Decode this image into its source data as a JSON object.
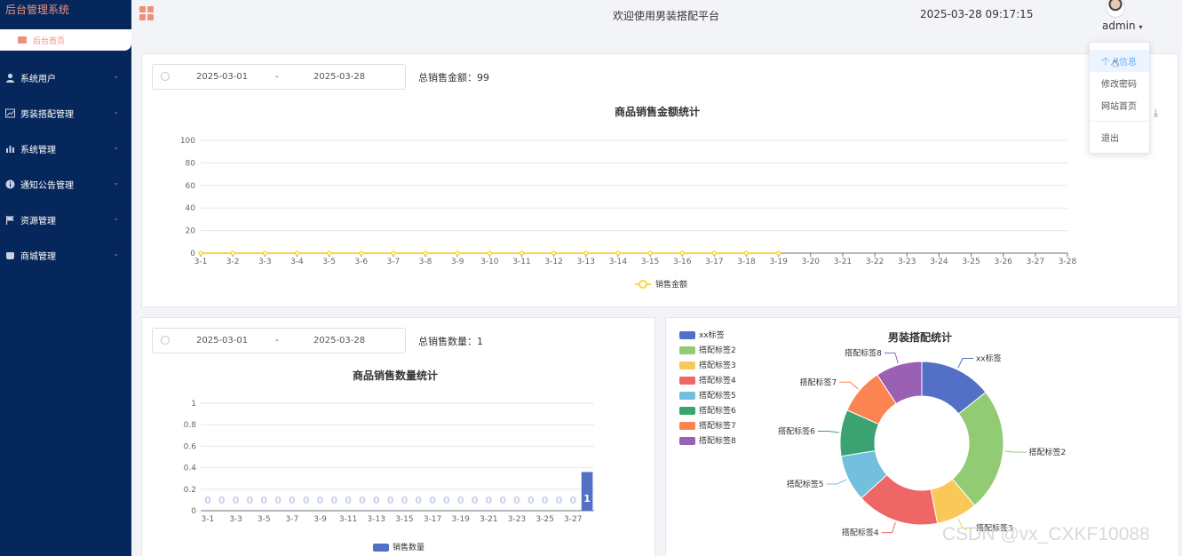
{
  "app": {
    "title": "后台管理系统",
    "home_tab": "后台首页"
  },
  "sidebar": {
    "items": [
      {
        "label": "系统用户",
        "icon": "user-icon"
      },
      {
        "label": "男装搭配管理",
        "icon": "chart-icon"
      },
      {
        "label": "系统管理",
        "icon": "bar-icon"
      },
      {
        "label": "通知公告管理",
        "icon": "info-icon"
      },
      {
        "label": "资源管理",
        "icon": "flag-icon"
      },
      {
        "label": "商城管理",
        "icon": "shop-icon"
      }
    ]
  },
  "header": {
    "welcome": "欢迎使用男装搭配平台",
    "datetime": "2025-03-28 09:17:15",
    "user": "admin"
  },
  "dropdown": {
    "items": [
      "个人信息",
      "修改密码",
      "网站首页",
      "退出"
    ]
  },
  "sales_amount": {
    "start": "2025-03-01",
    "sep": "-",
    "end": "2025-03-28",
    "total_label": "总销售金额：",
    "total": "99"
  },
  "sales_qty": {
    "start": "2025-03-01",
    "sep": "-",
    "end": "2025-03-28",
    "total_label": "总销售数量：",
    "total": "1"
  },
  "watermark": "CSDN @vx_CXKF10088",
  "colors": {
    "sidebar": "#06275b",
    "accent": "#f08f7a",
    "line": "#f7d64a",
    "bar": "#5470c6"
  },
  "chart_data": [
    {
      "type": "line",
      "title": "商品销售金额统计",
      "categories": [
        "3-1",
        "3-2",
        "3-3",
        "3-4",
        "3-5",
        "3-6",
        "3-7",
        "3-8",
        "3-9",
        "3-10",
        "3-11",
        "3-12",
        "3-13",
        "3-14",
        "3-15",
        "3-16",
        "3-17",
        "3-18",
        "3-19",
        "3-20",
        "3-21",
        "3-22",
        "3-23",
        "3-24",
        "3-25",
        "3-26",
        "3-27",
        "3-28"
      ],
      "series": [
        {
          "name": "销售金额",
          "values": [
            0,
            0,
            0,
            0,
            0,
            0,
            0,
            0,
            0,
            0,
            0,
            0,
            0,
            0,
            0,
            0,
            0,
            0,
            0
          ]
        }
      ],
      "ylim": [
        0,
        100
      ],
      "yticks": [
        "0",
        "20",
        "40",
        "60",
        "80",
        "100"
      ]
    },
    {
      "type": "bar",
      "title": "商品销售数量统计",
      "categories": [
        "3-1",
        "3-2",
        "3-3",
        "3-4",
        "3-5",
        "3-6",
        "3-7",
        "3-8",
        "3-9",
        "3-10",
        "3-11",
        "3-12",
        "3-13",
        "3-14",
        "3-15",
        "3-16",
        "3-17",
        "3-18",
        "3-19",
        "3-20",
        "3-21",
        "3-22",
        "3-23",
        "3-24",
        "3-25",
        "3-26",
        "3-27",
        "3-28"
      ],
      "tick_labels": [
        "3-1",
        "3-3",
        "3-5",
        "3-7",
        "3-9",
        "3-11",
        "3-13",
        "3-15",
        "3-17",
        "3-19",
        "3-21",
        "3-23",
        "3-25",
        "3-27"
      ],
      "series": [
        {
          "name": "销售数量",
          "values": [
            0,
            0,
            0,
            0,
            0,
            0,
            0,
            0,
            0,
            0,
            0,
            0,
            0,
            0,
            0,
            0,
            0,
            0,
            0,
            0,
            0,
            0,
            0,
            0,
            0,
            0,
            0,
            1
          ]
        }
      ],
      "data_labels": [
        "0",
        "0",
        "0",
        "0",
        "0",
        "0",
        "0",
        "0",
        "0",
        "0",
        "0",
        "0",
        "0",
        "0",
        "0",
        "0",
        "0",
        "0",
        "0",
        "0",
        "0",
        "0",
        "0",
        "0",
        "0",
        "0",
        "0",
        "1"
      ],
      "ylim": [
        0,
        1
      ],
      "yticks": [
        "0",
        "0.2",
        "0.4",
        "0.6",
        "0.8",
        "1"
      ]
    },
    {
      "type": "pie",
      "title": "男装搭配统计",
      "legend_position": "top-left",
      "labels": [
        "xx标签",
        "搭配标签2",
        "搭配标签3",
        "搭配标签4",
        "搭配标签5",
        "搭配标签6",
        "搭配标签7",
        "搭配标签8"
      ],
      "values": [
        14,
        24,
        8,
        16,
        9,
        9,
        9,
        9
      ],
      "colors": [
        "#5470c6",
        "#91cc75",
        "#fac858",
        "#ee6666",
        "#73c0de",
        "#3ba272",
        "#fc8452",
        "#9a60b4"
      ]
    }
  ]
}
